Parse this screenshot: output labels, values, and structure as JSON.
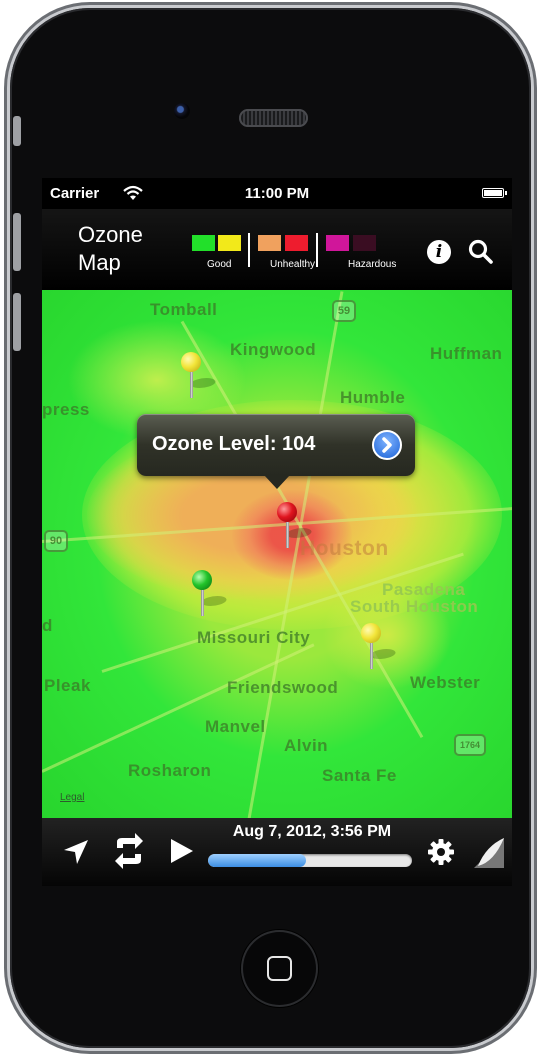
{
  "status_bar": {
    "carrier": "Carrier",
    "time": "11:00 PM"
  },
  "toolbar": {
    "title_line1": "Ozone",
    "title_line2": "Map",
    "legend": {
      "good_label": "Good",
      "unhealthy_label": "Unhealthy",
      "hazardous_label": "Hazardous",
      "colors": [
        "#22e02a",
        "#f2e91a",
        "#f0a15e",
        "#ee1c2e",
        "#d0169a",
        "#3a0d22"
      ]
    },
    "icons": [
      "info-icon",
      "search-icon"
    ]
  },
  "map": {
    "places": [
      "Tomball",
      "Kingwood",
      "Huffman",
      "Humble",
      "Houston",
      "Pasadena",
      "South Houston",
      "Missouri City",
      "Friendswood",
      "Pleak",
      "Webster",
      "Manvel",
      "Alvin",
      "Rosharon",
      "Santa Fe",
      "press",
      "d"
    ],
    "highways": [
      "59",
      "90",
      "1764"
    ],
    "legal": "Legal",
    "callout": {
      "text": "Ozone Level: 104"
    },
    "pins": [
      {
        "color": "yellow",
        "hex": "#f2e53a"
      },
      {
        "color": "red",
        "hex": "#e0151f"
      },
      {
        "color": "green",
        "hex": "#22c42a"
      },
      {
        "color": "yellow",
        "hex": "#f2e53a"
      }
    ]
  },
  "bottom_bar": {
    "datetime": "Aug 7, 2012, 3:56 PM",
    "progress_fraction": 0.48,
    "icons": [
      "location-arrow-icon",
      "refresh-icon",
      "play-icon",
      "gear-icon",
      "page-curl-icon"
    ]
  }
}
